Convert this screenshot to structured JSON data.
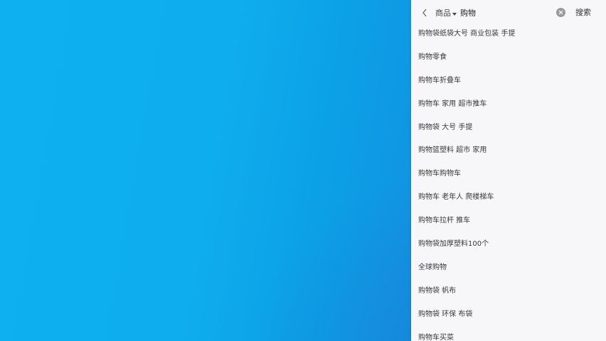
{
  "search": {
    "category": "商品",
    "category_dropdown_icon": "caret-down-icon",
    "query": "购物",
    "clear_icon": "clear-icon",
    "submit_label": "搜索",
    "back_icon": "back-arrow-icon"
  },
  "suggestions": [
    "购物袋纸袋大号 商业包装 手提",
    "购物零食",
    "购物车折叠车",
    "购物车 家用 超市推车",
    "购物袋 大号 手提",
    "购物篮塑料 超市 家用",
    "购物车购物车",
    "购物车 老年人 爬楼梯车",
    "购物车拉杆 推车",
    "购物袋加厚塑料100个",
    "全球购物",
    "购物袋 帆布",
    "购物袋 环保 布袋",
    "购物车买菜"
  ]
}
